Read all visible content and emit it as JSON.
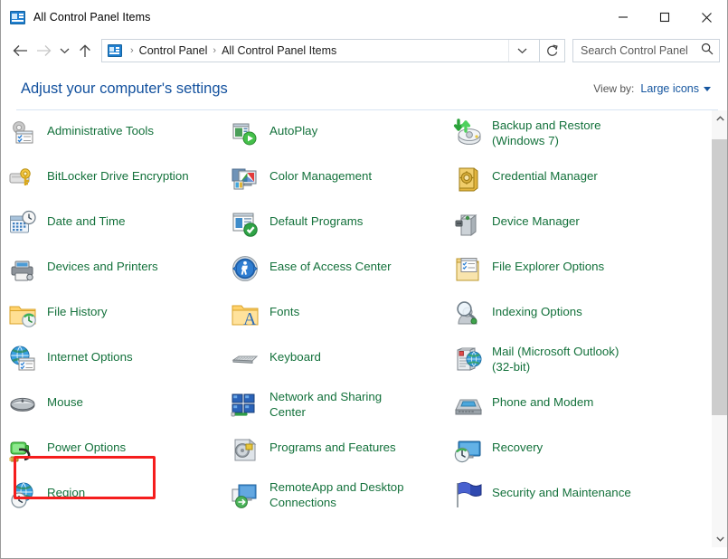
{
  "window": {
    "title": "All Control Panel Items",
    "title_icon": "control-panel-icon",
    "minimize_label": "Minimize",
    "maximize_label": "Maximize",
    "close_label": "Close"
  },
  "addressbar": {
    "back_label": "Back",
    "forward_label": "Forward",
    "recent_label": "Recent locations",
    "up_label": "Up one level",
    "breadcrumbs": [
      "Control Panel",
      "All Control Panel Items"
    ],
    "separator": "›",
    "dropdown_label": "Previous locations",
    "refresh_label": "Refresh"
  },
  "search": {
    "placeholder": "Search Control Panel",
    "value": "",
    "icon": "search-icon"
  },
  "header": {
    "title": "Adjust your computer's settings",
    "view_by_label": "View by:",
    "view_by_value": "Large icons"
  },
  "colors": {
    "link_green": "#13713b",
    "title_blue": "#13519e",
    "highlight_red": "#f51d1d"
  },
  "highlight": {
    "target": "Power Options",
    "color": "#f51d1d"
  },
  "items": [
    {
      "label": "Administrative Tools",
      "icon": "administrative-tools-icon",
      "col": 0,
      "row": 0,
      "lines": 1
    },
    {
      "label": "BitLocker Drive Encryption",
      "icon": "bitlocker-icon",
      "col": 0,
      "row": 1,
      "lines": 1
    },
    {
      "label": "Date and Time",
      "icon": "date-and-time-icon",
      "col": 0,
      "row": 2,
      "lines": 1
    },
    {
      "label": "Devices and Printers",
      "icon": "devices-and-printers-icon",
      "col": 0,
      "row": 3,
      "lines": 1
    },
    {
      "label": "File History",
      "icon": "file-history-icon",
      "col": 0,
      "row": 4,
      "lines": 1
    },
    {
      "label": "Internet Options",
      "icon": "internet-options-icon",
      "col": 0,
      "row": 5,
      "lines": 1
    },
    {
      "label": "Mouse",
      "icon": "mouse-icon",
      "col": 0,
      "row": 6,
      "lines": 1
    },
    {
      "label": "Power Options",
      "icon": "power-options-icon",
      "col": 0,
      "row": 7,
      "lines": 1
    },
    {
      "label": "Region",
      "icon": "region-icon",
      "col": 0,
      "row": 8,
      "lines": 1
    },
    {
      "label": "AutoPlay",
      "icon": "autoplay-icon",
      "col": 1,
      "row": 0,
      "lines": 1
    },
    {
      "label": "Color Management",
      "icon": "color-management-icon",
      "col": 1,
      "row": 1,
      "lines": 1
    },
    {
      "label": "Default Programs",
      "icon": "default-programs-icon",
      "col": 1,
      "row": 2,
      "lines": 1
    },
    {
      "label": "Ease of Access Center",
      "icon": "ease-of-access-icon",
      "col": 1,
      "row": 3,
      "lines": 1
    },
    {
      "label": "Fonts",
      "icon": "fonts-icon",
      "col": 1,
      "row": 4,
      "lines": 1
    },
    {
      "label": "Keyboard",
      "icon": "keyboard-icon",
      "col": 1,
      "row": 5,
      "lines": 1
    },
    {
      "label": "Network and Sharing\nCenter",
      "icon": "network-sharing-icon",
      "col": 1,
      "row": 6,
      "lines": 2
    },
    {
      "label": "Programs and Features",
      "icon": "programs-features-icon",
      "col": 1,
      "row": 7,
      "lines": 1
    },
    {
      "label": "RemoteApp and Desktop\nConnections",
      "icon": "remoteapp-icon",
      "col": 1,
      "row": 8,
      "lines": 2
    },
    {
      "label": "Backup and Restore\n(Windows 7)",
      "icon": "backup-restore-icon",
      "col": 2,
      "row": 0,
      "lines": 2
    },
    {
      "label": "Credential Manager",
      "icon": "credential-manager-icon",
      "col": 2,
      "row": 1,
      "lines": 1
    },
    {
      "label": "Device Manager",
      "icon": "device-manager-icon",
      "col": 2,
      "row": 2,
      "lines": 1
    },
    {
      "label": "File Explorer Options",
      "icon": "file-explorer-options-icon",
      "col": 2,
      "row": 3,
      "lines": 1
    },
    {
      "label": "Indexing Options",
      "icon": "indexing-options-icon",
      "col": 2,
      "row": 4,
      "lines": 1
    },
    {
      "label": "Mail (Microsoft Outlook)\n(32-bit)",
      "icon": "mail-icon",
      "col": 2,
      "row": 5,
      "lines": 2
    },
    {
      "label": "Phone and Modem",
      "icon": "phone-modem-icon",
      "col": 2,
      "row": 6,
      "lines": 1
    },
    {
      "label": "Recovery",
      "icon": "recovery-icon",
      "col": 2,
      "row": 7,
      "lines": 1
    },
    {
      "label": "Security and Maintenance",
      "icon": "security-maintenance-icon",
      "col": 2,
      "row": 8,
      "lines": 1
    }
  ],
  "scrollbar": {
    "up_arrow": "chevron-up-icon",
    "down_arrow": "chevron-down-icon",
    "thumb_top_pct": 3,
    "thumb_height_pct": 63
  }
}
